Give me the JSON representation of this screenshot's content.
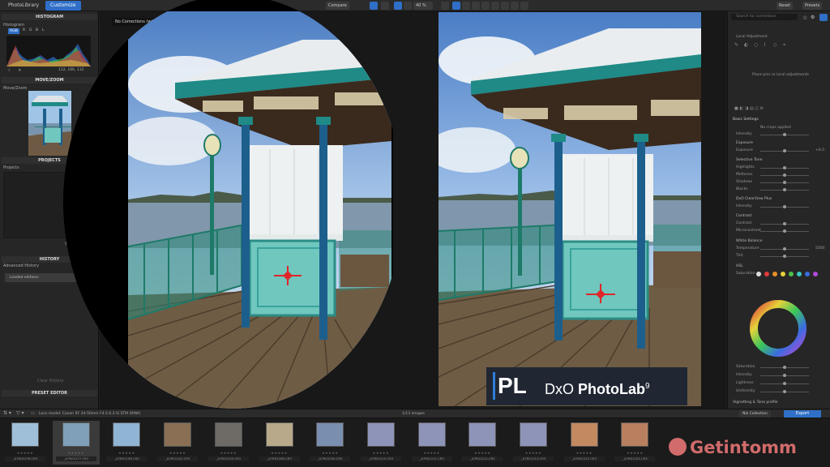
{
  "tabs": {
    "photolibrary": "PhotoLibrary",
    "customize": "Customize"
  },
  "toolbar": {
    "compare": "Compare",
    "zoom": "40 %",
    "reset": "Reset",
    "presets": "Presets"
  },
  "left": {
    "histogram_title": "HISTOGRAM",
    "histogram_label": "Histogram",
    "channels": [
      "RGB",
      "R",
      "G",
      "B",
      "L"
    ],
    "histogram_values": "112, 106, 112",
    "movezoom_title": "MOVE/ZOOM",
    "movezoom_label": "Move/Zoom",
    "projects_title": "PROJECTS",
    "projects_label": "Projects",
    "history_title": "HISTORY",
    "history_label": "Advanced History",
    "history_item": "Loaded editions",
    "history_clear": "Clear History",
    "preset_editor_title": "PRESET EDITOR"
  },
  "viewer": {
    "corrections_tooltip": "No Corrections (without Geometry)"
  },
  "right": {
    "search_placeholder": "Search for corrections",
    "local_adjust": "Local Adjustment",
    "local_hint": "Place pins or local adjustments",
    "basic_settings": "Basic Settings",
    "white_balance_label": "No crops applied",
    "exposure": "Exposure",
    "exposure_value": "+0.0",
    "selective_tone": "Selective Tone",
    "highlights": "Highlights",
    "midtones": "Midtones",
    "shadows": "Shadows",
    "blacks": "Blacks",
    "clearview": "DxO ClearView Plus",
    "intensity": "Intensity",
    "contrast": "Contrast",
    "microcontrast": "Microcontrast",
    "white_balance": "White Balance",
    "temperature": "Temperature",
    "temperature_value": "5000",
    "tint": "Tint",
    "hsl": "HSL",
    "saturation": "Saturation",
    "lightness": "Lightness",
    "uniformity": "Uniformity",
    "vignetting": "Vignetting & Tone profile"
  },
  "filmbar": {
    "lens_label": "Lens model: Canon RF 24-50mm F4.5-6.3 IS STM (RAW)",
    "count": "1/13 images",
    "nik": "Nik Collection",
    "export": "Export"
  },
  "thumbnails": [
    {
      "name": "_A7R01076.CR3",
      "stars": "★★★★★"
    },
    {
      "name": "_A7R01077.CR3",
      "stars": "★★★★★"
    },
    {
      "name": "_A7R01198.CR3",
      "stars": "★★★★★"
    },
    {
      "name": "_A7R01201.CR3",
      "stars": "★★★★★"
    },
    {
      "name": "_A7R01205.CR3",
      "stars": "★★★★★"
    },
    {
      "name": "_A7R01208.CR3",
      "stars": "★★★★★"
    },
    {
      "name": "_A7R01209.CR3",
      "stars": "★★★★★"
    },
    {
      "name": "_A7R01210.CR3",
      "stars": "★★★★★"
    },
    {
      "name": "_A7R01211.CR3",
      "stars": "★★★★★"
    },
    {
      "name": "_A7R01212.CR3",
      "stars": "★★★★★"
    },
    {
      "name": "_A7R01213.CR3",
      "stars": "★★★★★"
    },
    {
      "name": "_A7R01222.CR3",
      "stars": "★★★★★"
    },
    {
      "name": "_A7R01224.CR3",
      "stars": "★★★★★"
    }
  ],
  "logo": {
    "mark": "PL",
    "brand": "DxO ",
    "product": "PhotoLab",
    "version": "9"
  },
  "watermark": "Getintomm",
  "colors": {
    "accent": "#2f6fc7",
    "teal": "#1f8a86",
    "blue_post": "#1d5f8c",
    "mint": "#6fc7be"
  }
}
